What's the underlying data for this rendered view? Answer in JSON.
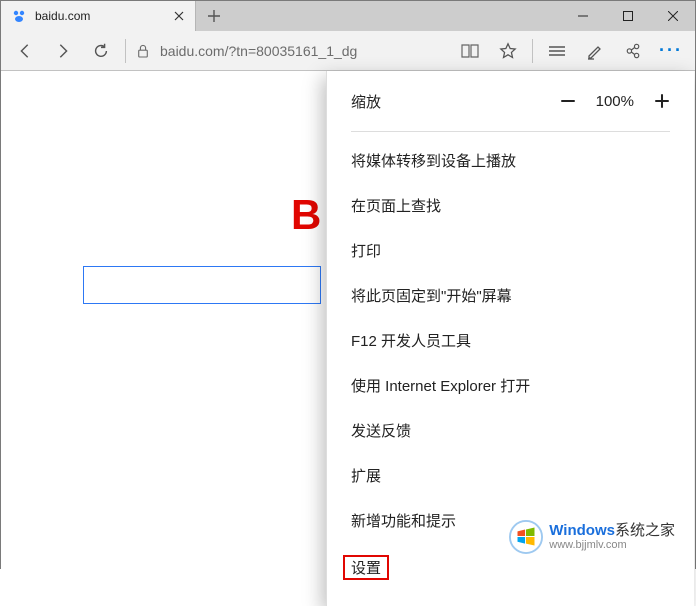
{
  "tab": {
    "title": "baidu.com",
    "favicon_color": "#3385ff"
  },
  "address_bar": {
    "url_display": "baidu.com/?tn=80035161_1_dg"
  },
  "window_controls": {
    "minimize": "—",
    "maximize": "□",
    "close": "×"
  },
  "page": {
    "logo_fragment": "B"
  },
  "menu": {
    "zoom": {
      "label": "缩放",
      "value": "100%"
    },
    "items": [
      "将媒体转移到设备上播放",
      "在页面上查找",
      "打印",
      "将此页固定到\"开始\"屏幕",
      "F12 开发人员工具",
      "使用 Internet Explorer 打开",
      "发送反馈",
      "扩展",
      "新增功能和提示"
    ],
    "settings": "设置"
  },
  "watermark": {
    "brand_accent": "Windows",
    "brand_rest": "系统之家",
    "url": "www.bjjmlv.com"
  }
}
